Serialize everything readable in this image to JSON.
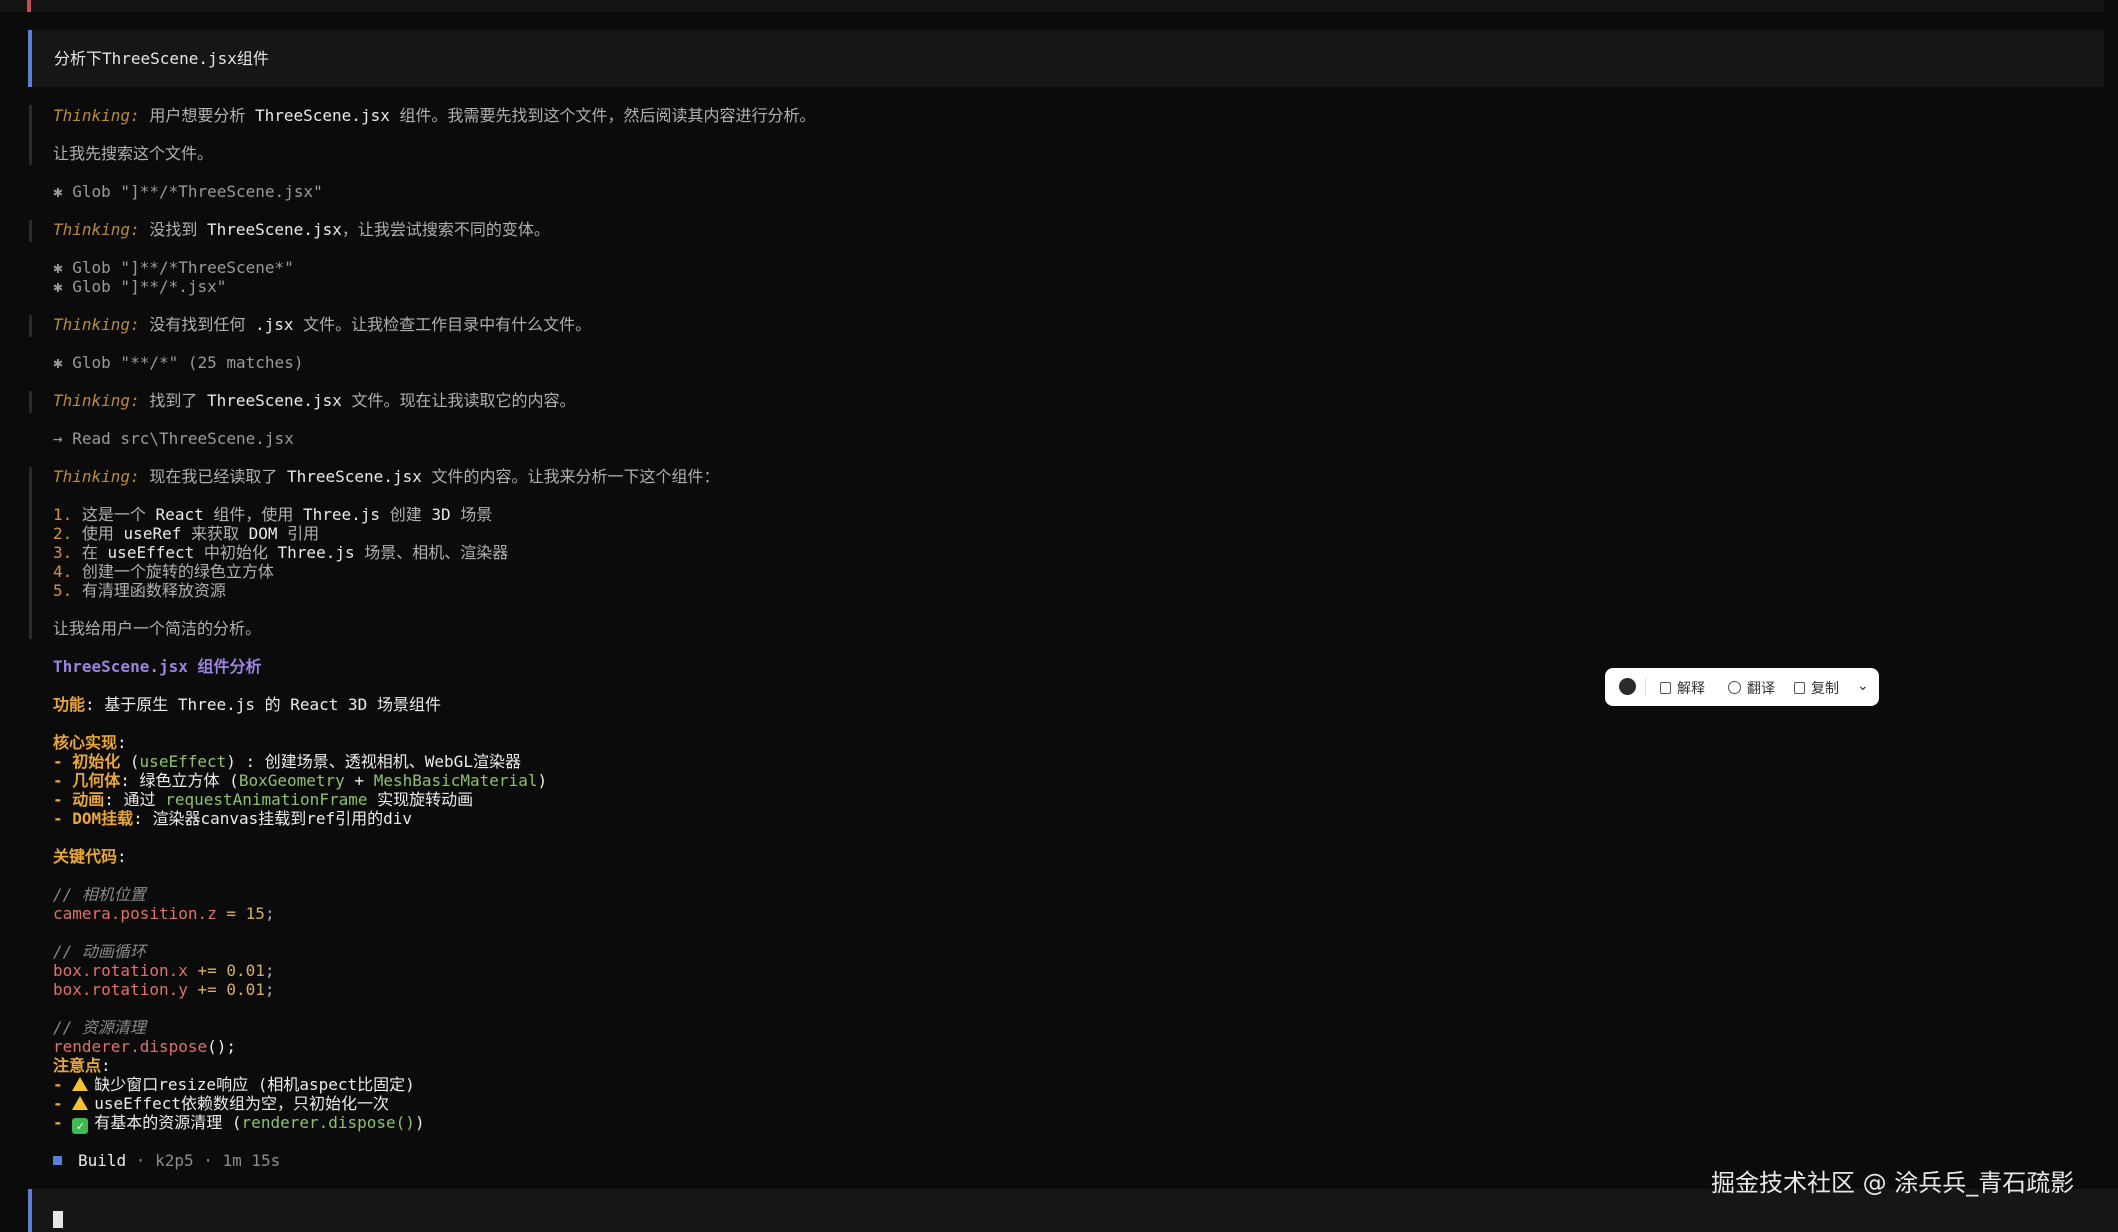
{
  "user_prompt": "分析下ThreeScene.jsx组件",
  "thinking_label": "Thinking:",
  "t1_a": "用户想要分析 ",
  "t1_b": "ThreeScene.jsx",
  "t1_c": " 组件。我需要先找到这个文件，然后阅读其内容进行分析。",
  "t1_follow": "让我先搜索这个文件。",
  "glob1": "✱ Glob \"]**/*ThreeScene.jsx\"",
  "t2_a": "没找到 ",
  "t2_b": "ThreeScene.jsx",
  "t2_c": "，让我尝试搜索不同的变体。",
  "glob2": "✱ Glob \"]**/*ThreeScene*\"",
  "glob3": "✱ Glob \"]**/*.jsx\"",
  "t3_a": "没有找到任何 ",
  "t3_b": ".jsx",
  "t3_c": " 文件。让我检查工作目录中有什么文件。",
  "glob4": "✱ Glob \"**/*\" (25 matches)",
  "t4_a": "找到了 ",
  "t4_b": "ThreeScene.jsx",
  "t4_c": " 文件。现在让我读取它的内容。",
  "read": "→ Read src\\ThreeScene.jsx",
  "t5_a": "现在我已经读取了 ",
  "t5_b": "ThreeScene.jsx",
  "t5_c": " 文件的内容。让我来分析一下这个组件：",
  "list": [
    {
      "n": "1.",
      "a": "这是一个 ",
      "b": "React",
      "c": " 组件，使用 ",
      "d": "Three.js",
      "e": " 创建 ",
      "f": "3D",
      "g": " 场景"
    },
    {
      "n": "2.",
      "a": "使用 ",
      "b": "useRef",
      "c": " 来获取 ",
      "d": "DOM",
      "e": " 引用",
      "f": "",
      "g": ""
    },
    {
      "n": "3.",
      "a": "在 ",
      "b": "useEffect",
      "c": " 中初始化 ",
      "d": "Three.js",
      "e": " 场景、相机、渲染器",
      "f": "",
      "g": ""
    },
    {
      "n": "4.",
      "a": "创建一个旋转的绿色立方体",
      "b": "",
      "c": "",
      "d": "",
      "e": "",
      "f": "",
      "g": ""
    },
    {
      "n": "5.",
      "a": "有清理函数释放资源",
      "b": "",
      "c": "",
      "d": "",
      "e": "",
      "f": "",
      "g": ""
    }
  ],
  "t5_follow": "让我给用户一个简洁的分析。",
  "answer_title": "ThreeScene.jsx 组件分析",
  "func_key": "功能",
  "func_sep": ": ",
  "func_text": "基于原生 Three.js 的 React 3D 场景组件",
  "core_key": "核心实现",
  "colon": ":",
  "dash": "- ",
  "b1_key": "初始化",
  "b1_a": " (",
  "b1_code": "useEffect",
  "b1_b": ") : 创建场景、透视相机、WebGL渲染器",
  "b2_key": "几何体",
  "b2_a": ": 绿色立方体 (",
  "b2_code1": "BoxGeometry",
  "b2_plus": " + ",
  "b2_code2": "MeshBasicMaterial",
  "b2_b": ")",
  "b3_key": "动画",
  "b3_a": ": 通过 ",
  "b3_code": "requestAnimationFrame",
  "b3_b": " 实现旋转动画",
  "b4_key": "DOM挂载",
  "b4_a": ": 渲染器canvas挂载到ref引用的div",
  "code_key": "关键代码",
  "c1_comment": "// 相机位置",
  "c1_prop": "camera.position.z",
  "c1_op": " = ",
  "c1_val": "15",
  "semi": ";",
  "c2_comment": "// 动画循环",
  "c2_prop1": "box.rotation.x",
  "c2_prop2": "box.rotation.y",
  "c2_op": " += ",
  "c2_val": "0.01",
  "c3_comment": "// 资源清理",
  "c3_prop": "renderer.dispose",
  "c3_call": "();",
  "note_key": "注意点",
  "n1": "缺少窗口resize响应 (相机aspect比固定)",
  "n2": "useEffect依赖数组为空，只初始化一次",
  "n3_a": "有基本的资源清理 (",
  "n3_code": "renderer.dispose()",
  "n3_b": ")",
  "build_label": "Build",
  "build_meta": " · k2p5 · 1m 15s",
  "toolbar": {
    "explain": "解释",
    "translate": "翻译",
    "copy": "复制",
    "more": "⌄"
  },
  "watermark": "掘金技术社区 @ 涂兵兵_青石疏影"
}
